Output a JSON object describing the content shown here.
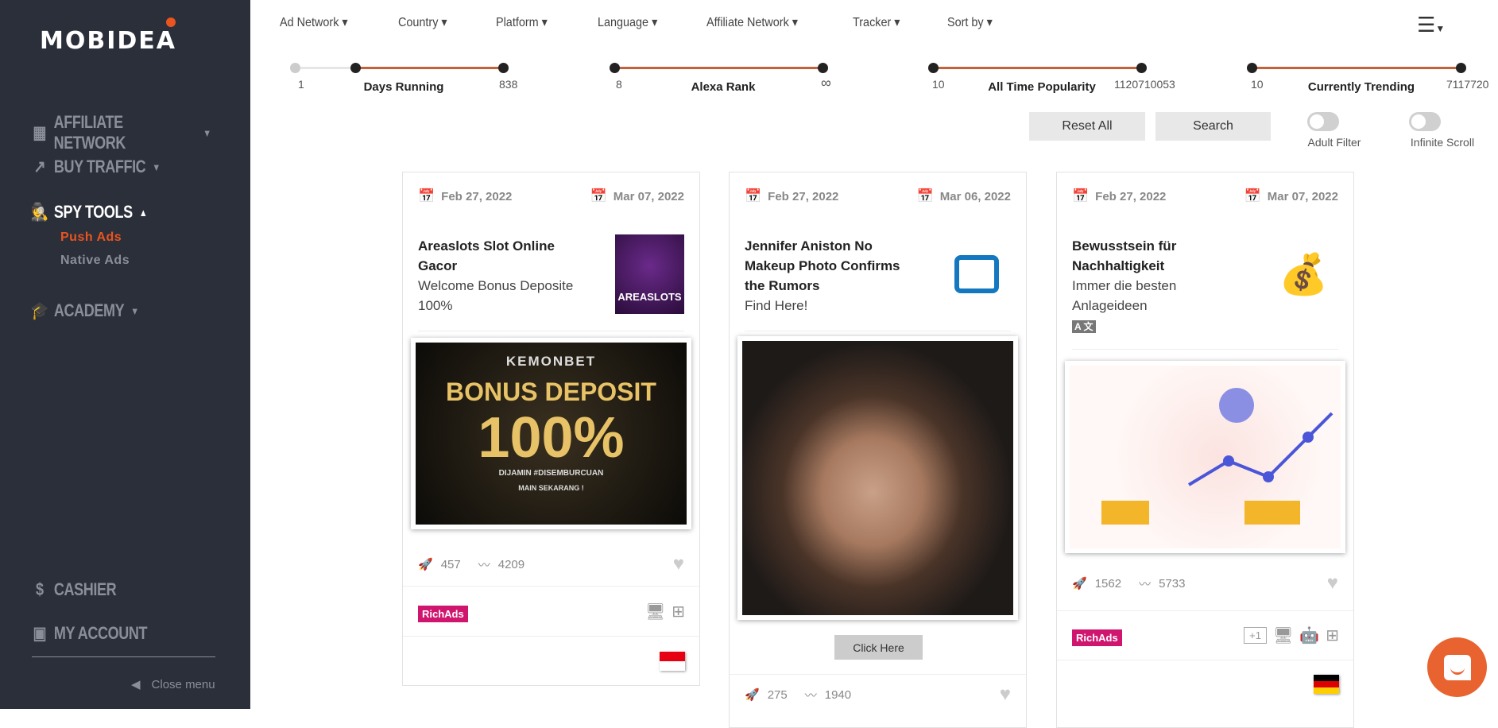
{
  "brand": {
    "name": "MOBIDEA",
    "accent": "#e9541f"
  },
  "sidebar": {
    "items": [
      {
        "label": "AFFILIATE NETWORK",
        "icon": "bar-chart-icon"
      },
      {
        "label": "BUY TRAFFIC",
        "icon": "trending-icon"
      },
      {
        "label": "SPY TOOLS",
        "icon": "spy-icon",
        "active": true,
        "sub": [
          {
            "label": "Push Ads",
            "active": true
          },
          {
            "label": "Native Ads"
          }
        ]
      },
      {
        "label": "ACADEMY",
        "icon": "graduation-cap-icon"
      },
      {
        "label": "CASHIER",
        "icon": "dollar-icon"
      },
      {
        "label": "MY ACCOUNT",
        "icon": "account-icon"
      }
    ],
    "close_menu": "Close menu"
  },
  "filters": [
    "Ad Network",
    "Country",
    "Platform",
    "Language",
    "Affiliate Network",
    "Tracker",
    "Sort by"
  ],
  "sliders": [
    {
      "label": "Days Running",
      "min": "1",
      "max": "838",
      "range": [
        "1",
        "838"
      ]
    },
    {
      "label": "Alexa Rank",
      "min": "8",
      "max": "∞"
    },
    {
      "label": "All Time Popularity",
      "min": "10",
      "max": "1120710053"
    },
    {
      "label": "Currently Trending",
      "min": "10",
      "max": "7117720"
    }
  ],
  "buttons": {
    "reset": "Reset All",
    "search": "Search"
  },
  "toggles": [
    {
      "label": "Adult Filter",
      "on": false
    },
    {
      "label": "Infinite Scroll",
      "on": false
    }
  ],
  "cards": [
    {
      "first_seen": "Feb 27, 2022",
      "last_seen": "Mar 07, 2022",
      "title": "Areaslots Slot Online Gacor",
      "desc": "Welcome Bonus Deposite 100%",
      "thumb_text": "AREASLOTS",
      "banner": [
        "KEMONBET",
        "BONUS DEPOSIT",
        "100%",
        "DIJAMIN #DISEMBURCUAN",
        "MAIN SEKARANG !"
      ],
      "impressions": "457",
      "trend": "4209",
      "network": "RichAds",
      "platforms": [
        "desktop-icon",
        "windows-icon"
      ],
      "flag": "Indonesia"
    },
    {
      "first_seen": "Feb 27, 2022",
      "last_seen": "Mar 06, 2022",
      "title": "Jennifer Aniston No Makeup Photo Confirms the Rumors",
      "desc": "Find Here!",
      "cta": "Click Here",
      "impressions": "275",
      "trend": "1940"
    },
    {
      "first_seen": "Feb 27, 2022",
      "last_seen": "Mar 07, 2022",
      "title": "Bewusstsein für Nachhaltigkeit",
      "desc": "Immer die besten Anlageideen",
      "impressions": "1562",
      "trend": "5733",
      "network": "RichAds",
      "platform_more": "+1",
      "platforms": [
        "desktop-icon",
        "android-icon",
        "windows-icon"
      ],
      "flag": "Germany"
    }
  ]
}
